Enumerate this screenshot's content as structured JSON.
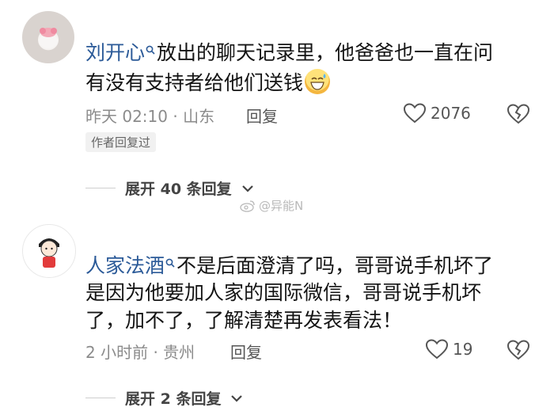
{
  "comments": [
    {
      "username": "",
      "mention": "刘开心",
      "text_line1": "放出的聊天记录里，他爸爸也一直在问",
      "text_line2": "有没有支持者给他们送钱",
      "time_location": "昨天 02:10 · 山东",
      "reply_label": "回复",
      "likes": "2076",
      "badge": "作者回复过",
      "expand_label": "展开 40 条回复"
    },
    {
      "username": "",
      "mention": "人家法酒",
      "text_line1": "不是后面澄清了吗，哥哥说手机坏了",
      "text_line2": "是因为他要加人家的国际微信，哥哥说手机坏",
      "text_line3": "了，加不了，了解清楚再发表看法！",
      "time_location": "2 小时前 · 贵州",
      "reply_label": "回复",
      "likes": "19",
      "expand_label": "展开 2 条回复"
    }
  ],
  "watermark": "@异能N",
  "colors": {
    "mention": "#2b5a98",
    "meta": "#8b8b8b",
    "text": "#141414"
  },
  "icons": [
    "heart-outline-icon",
    "broken-heart-icon",
    "chevron-down-icon",
    "weibo-icon",
    "search-mention-icon"
  ]
}
